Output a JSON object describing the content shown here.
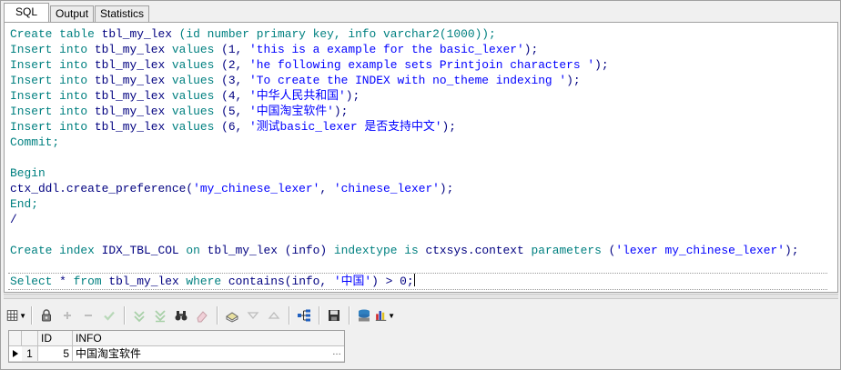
{
  "tabs": [
    {
      "label": "SQL",
      "active": true
    },
    {
      "label": "Output",
      "active": false
    },
    {
      "label": "Statistics",
      "active": false
    }
  ],
  "editor": {
    "lines": [
      [
        [
          "kw",
          "Create table "
        ],
        [
          "id",
          "tbl_my_lex "
        ],
        [
          "kw",
          "(id number primary key, info varchar2(1000));"
        ]
      ],
      [
        [
          "kw",
          "Insert into "
        ],
        [
          "id",
          "tbl_my_lex "
        ],
        [
          "kw",
          "values "
        ],
        [
          "id",
          "(1, "
        ],
        [
          "str",
          "'this is a example for the basic_lexer'"
        ],
        [
          "id",
          ");"
        ]
      ],
      [
        [
          "kw",
          "Insert into "
        ],
        [
          "id",
          "tbl_my_lex "
        ],
        [
          "kw",
          "values "
        ],
        [
          "id",
          "(2, "
        ],
        [
          "str",
          "'he following example sets Printjoin characters '"
        ],
        [
          "id",
          ");"
        ]
      ],
      [
        [
          "kw",
          "Insert into "
        ],
        [
          "id",
          "tbl_my_lex "
        ],
        [
          "kw",
          "values "
        ],
        [
          "id",
          "(3, "
        ],
        [
          "str",
          "'To create the INDEX with no_theme indexing '"
        ],
        [
          "id",
          ");"
        ]
      ],
      [
        [
          "kw",
          "Insert into "
        ],
        [
          "id",
          "tbl_my_lex "
        ],
        [
          "kw",
          "values "
        ],
        [
          "id",
          "(4, "
        ],
        [
          "str",
          "'中华人民共和国'"
        ],
        [
          "id",
          ");"
        ]
      ],
      [
        [
          "kw",
          "Insert into "
        ],
        [
          "id",
          "tbl_my_lex "
        ],
        [
          "kw",
          "values "
        ],
        [
          "id",
          "(5, "
        ],
        [
          "str",
          "'中国淘宝软件'"
        ],
        [
          "id",
          ");"
        ]
      ],
      [
        [
          "kw",
          "Insert into "
        ],
        [
          "id",
          "tbl_my_lex "
        ],
        [
          "kw",
          "values "
        ],
        [
          "id",
          "(6, "
        ],
        [
          "str",
          "'测试basic_lexer 是否支持中文'"
        ],
        [
          "id",
          ");"
        ]
      ],
      [
        [
          "kw",
          "Commit;"
        ]
      ],
      [],
      [
        [
          "kw",
          "Begin"
        ]
      ],
      [
        [
          "id",
          "ctx_ddl.create_preference("
        ],
        [
          "str",
          "'my_chinese_lexer'"
        ],
        [
          "id",
          ", "
        ],
        [
          "str",
          "'chinese_lexer'"
        ],
        [
          "id",
          ");"
        ]
      ],
      [
        [
          "kw",
          "End;"
        ]
      ],
      [
        [
          "id",
          "/"
        ]
      ],
      [],
      [
        [
          "kw",
          "Create index "
        ],
        [
          "id",
          "IDX_TBL_COL "
        ],
        [
          "kw",
          "on "
        ],
        [
          "id",
          "tbl_my_lex (info) "
        ],
        [
          "kw",
          "indextype is "
        ],
        [
          "id",
          "ctxsys.context "
        ],
        [
          "kw",
          "parameters "
        ],
        [
          "id",
          "("
        ],
        [
          "str",
          "'lexer my_chinese_lexer'"
        ],
        [
          "id",
          ");"
        ]
      ],
      [],
      [
        [
          "kw",
          "Select "
        ],
        [
          "id",
          "* "
        ],
        [
          "kw",
          "from "
        ],
        [
          "id",
          "tbl_my_lex "
        ],
        [
          "kw",
          "where "
        ],
        [
          "id",
          "contains(info, "
        ],
        [
          "str",
          "'中国'"
        ],
        [
          "id",
          ") > 0;"
        ]
      ]
    ]
  },
  "toolbar": {
    "buttons": [
      "grid-view-icon",
      "lock-icon",
      "add-icon",
      "remove-icon",
      "post-icon",
      "arrow-down-icon",
      "arrow-down-double-icon",
      "binoculars-icon",
      "eraser-icon",
      "import-icon",
      "triangle-down-icon",
      "triangle-up-icon",
      "tree-icon",
      "save-icon",
      "export-icon",
      "chart-icon"
    ]
  },
  "grid": {
    "columns": [
      "ID",
      "INFO"
    ],
    "rows": [
      {
        "row_number": "1",
        "id": "5",
        "info": "中国淘宝软件"
      }
    ]
  },
  "colors": {
    "keyword": "#008080",
    "identifier": "#000080",
    "string": "#0000ff"
  }
}
